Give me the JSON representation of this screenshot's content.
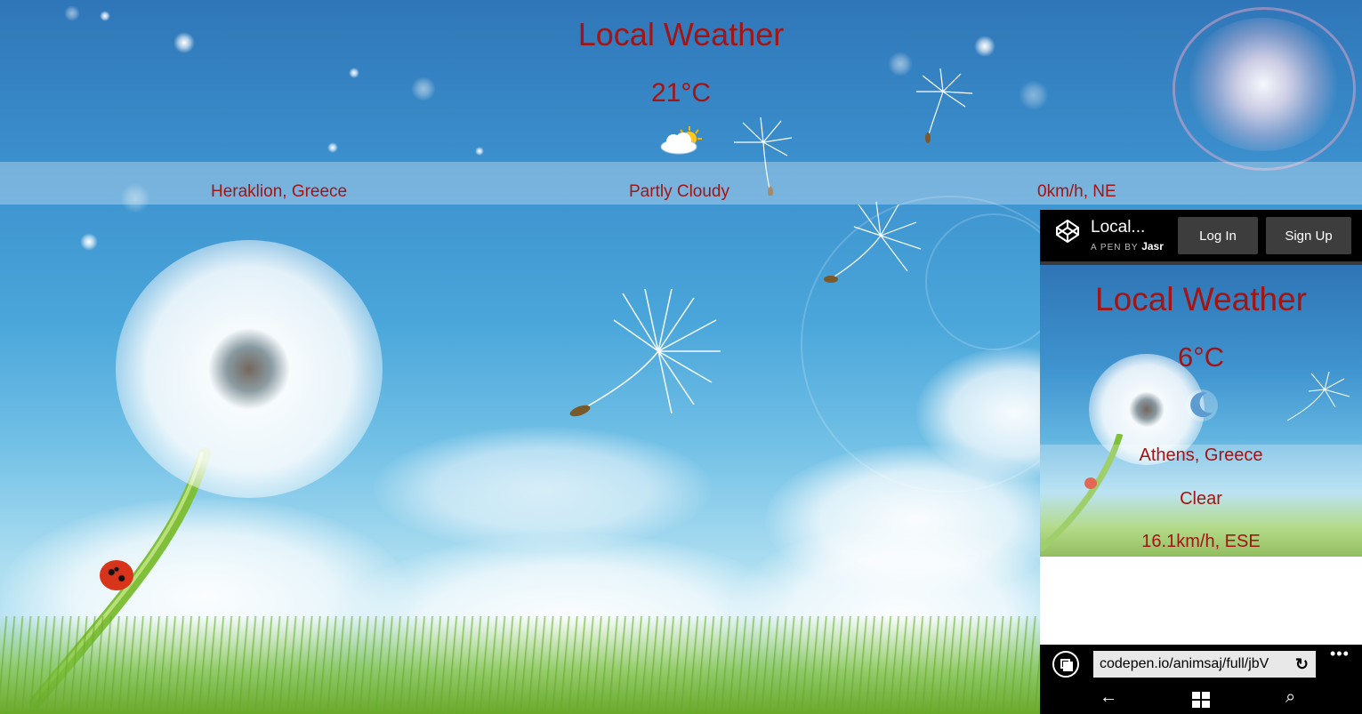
{
  "main": {
    "title": "Local Weather",
    "temperature": "21°C",
    "weather_icon": "partly-cloudy-icon",
    "location": "Heraklion, Greece",
    "condition": "Partly Cloudy",
    "wind": "0km/h, NE"
  },
  "phone": {
    "codepen": {
      "logo_icon": "codepen-logo-icon",
      "pen_title": "Local...",
      "pen_by_label": "A PEN BY",
      "author": "Jasr",
      "login_label": "Log In",
      "signup_label": "Sign Up"
    },
    "app": {
      "title": "Local Weather",
      "temperature": "6°C",
      "weather_icon": "moon-icon",
      "location": "Athens, Greece",
      "condition": "Clear",
      "wind": "16.1km/h, ESE"
    },
    "browser": {
      "tabs_icon": "tabs-icon",
      "address": "codepen.io/animsaj/full/jbV",
      "refresh_icon": "refresh-icon",
      "more_icon": "more-icon",
      "more_text": "•••"
    },
    "nav": {
      "back_icon": "back-arrow-icon",
      "back_glyph": "←",
      "windows_icon": "windows-logo-icon",
      "search_icon": "search-icon",
      "search_glyph": "⌕"
    }
  },
  "colors": {
    "accent_text": "#a31414",
    "codepen_bar": "#000000",
    "button_bg": "#3d3d3d"
  }
}
